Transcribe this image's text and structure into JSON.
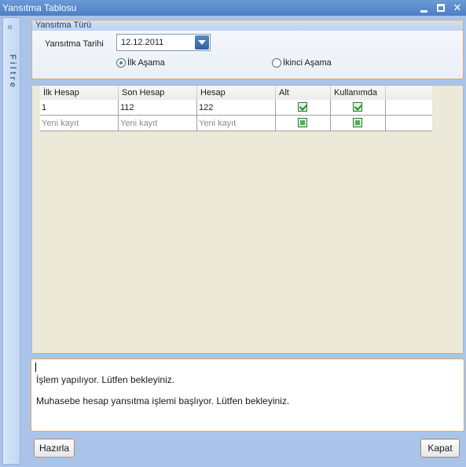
{
  "window": {
    "title": "Yansıtma Tablosu",
    "controls": [
      "minimize",
      "maximize",
      "close"
    ]
  },
  "filter_panel": {
    "label": "Filtre",
    "collapse_glyph": "«"
  },
  "group": {
    "title": "Yansıtma Türü",
    "date_label": "Yansıtma Tarihi",
    "date_value": "12.12.2011",
    "radios": [
      {
        "label": "İlk Aşama",
        "selected": true
      },
      {
        "label": "İkinci Aşama",
        "selected": false
      }
    ]
  },
  "grid": {
    "columns": [
      "İlk Hesap",
      "Son Hesap",
      "Hesap",
      "Alt",
      "Kullanımda"
    ],
    "rows": [
      {
        "ilk": "1",
        "son": "112",
        "hesap": "122",
        "alt": true,
        "kullanimda": true
      }
    ],
    "new_row_placeholder": "Yeni kayıt"
  },
  "log": {
    "lines": [
      "İşlem yapılıyor. Lütfen bekleyiniz.",
      "Muhasebe hesap yansıtma işlemi başlıyor. Lütfen bekleyiniz."
    ]
  },
  "buttons": {
    "prepare": "Hazırla",
    "close": "Kapat"
  },
  "colors": {
    "titlebar": "#4c7fc4",
    "group_border": "#e0a86a",
    "check_green": "#49b34f"
  }
}
